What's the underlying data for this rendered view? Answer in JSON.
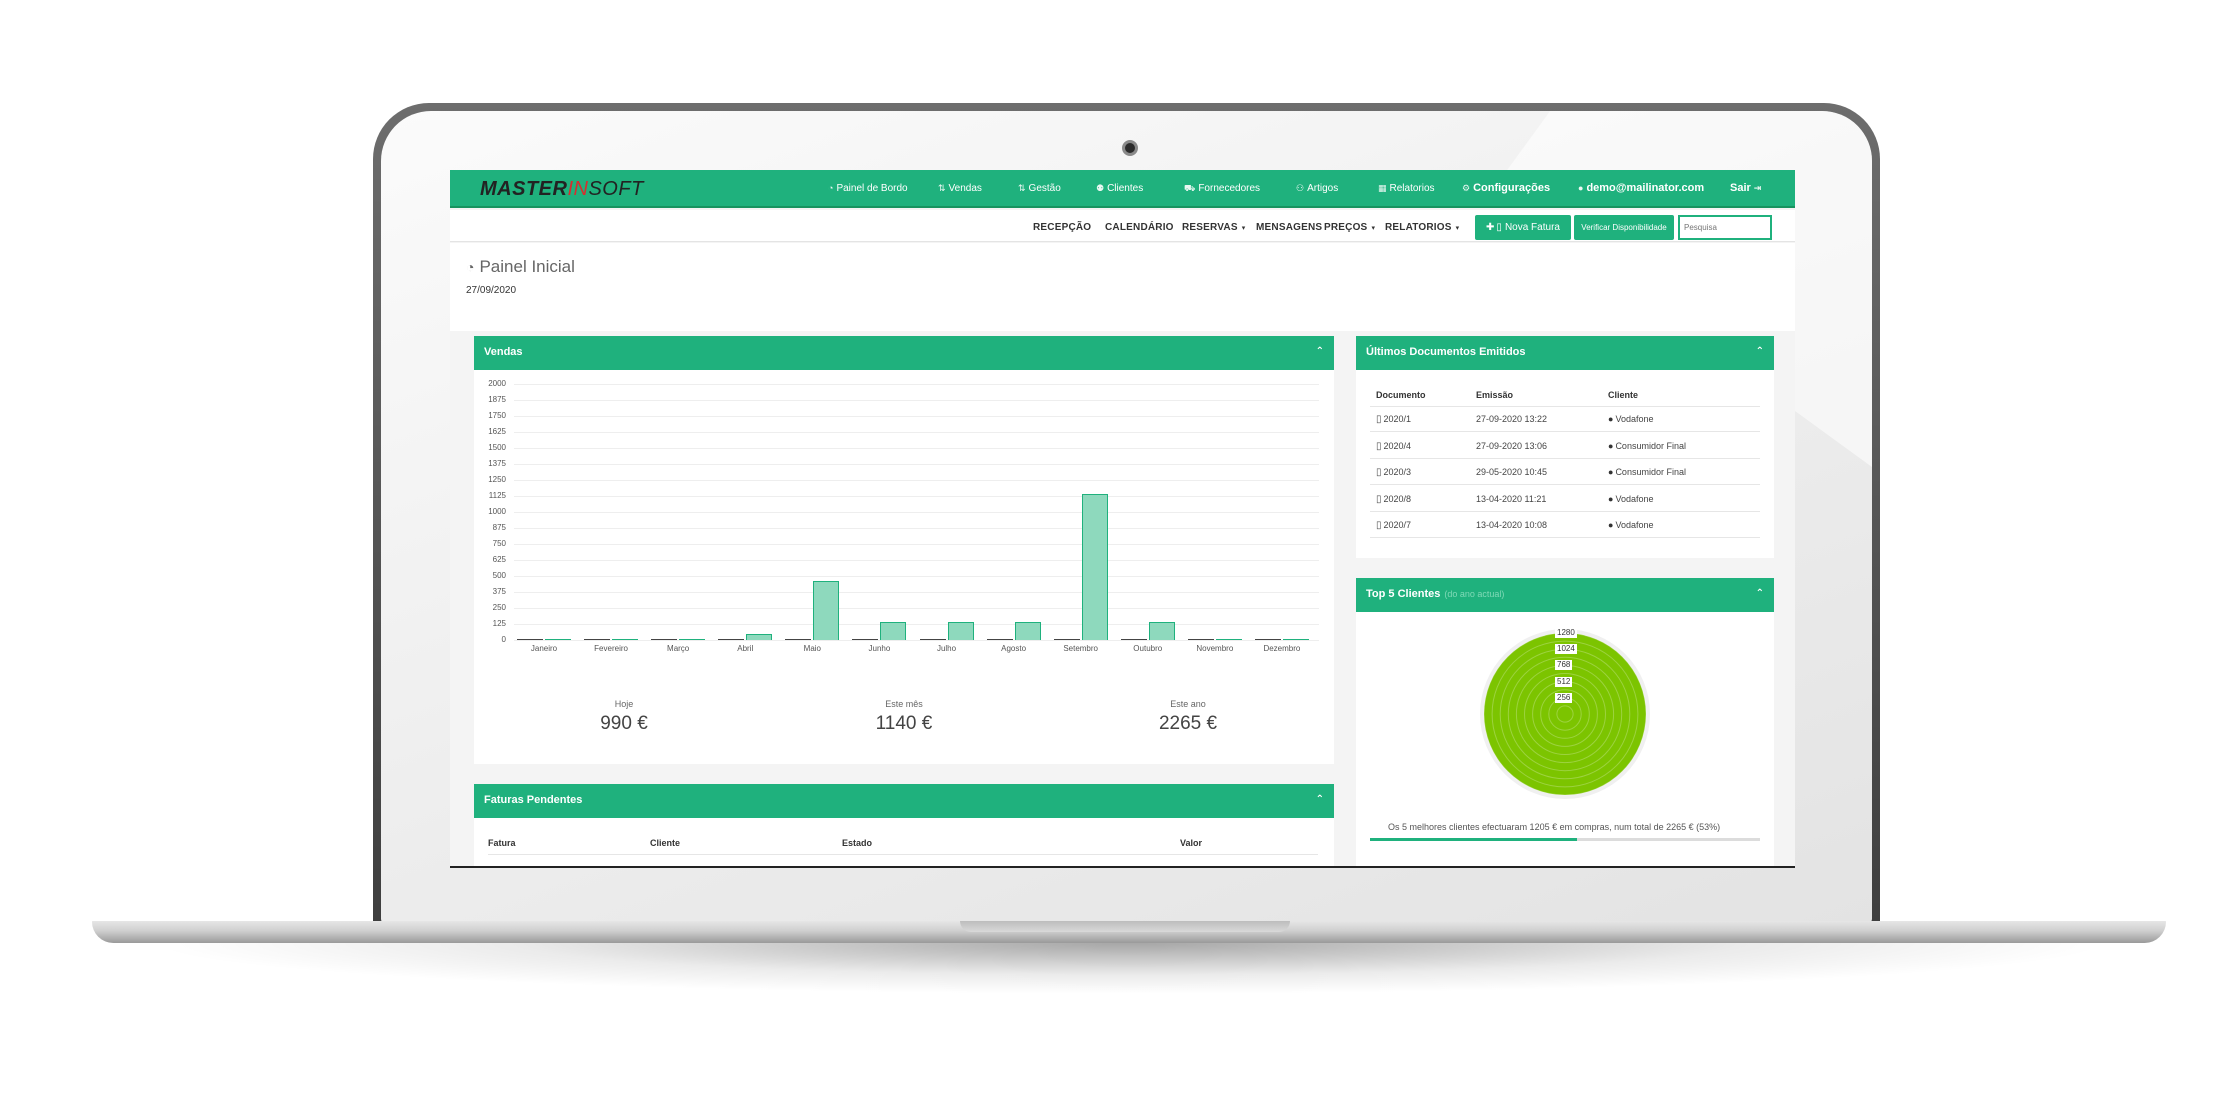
{
  "app": {
    "logo": {
      "part1": "MASTER",
      "part2": "IN",
      "part3": "SOFT"
    },
    "nav": [
      {
        "icon": "dashboard-icon",
        "label": "Painel de Bordo"
      },
      {
        "icon": "sales-icon",
        "label": "Vendas"
      },
      {
        "icon": "management-icon",
        "label": "Gestão"
      },
      {
        "icon": "clients-icon",
        "label": "Clientes"
      },
      {
        "icon": "suppliers-icon",
        "label": "Fornecedores"
      },
      {
        "icon": "articles-icon",
        "label": "Artigos"
      },
      {
        "icon": "reports-icon",
        "label": "Relatorios"
      },
      {
        "icon": "gears-icon",
        "label": "Configurações"
      },
      {
        "icon": "user-icon",
        "label": "demo@mailinator.com"
      },
      {
        "icon": "logout-icon",
        "label": "Sair"
      }
    ],
    "subnav": [
      {
        "label": "RECEPÇÃO",
        "dropdown": false
      },
      {
        "label": "CALENDÁRIO",
        "dropdown": false
      },
      {
        "label": "RESERVAS",
        "dropdown": true
      },
      {
        "label": "MENSAGENS",
        "dropdown": false
      },
      {
        "label": "PREÇOS",
        "dropdown": true
      },
      {
        "label": "RELATORIOS",
        "dropdown": true
      }
    ],
    "actions": {
      "new_invoice": "Nova Fatura",
      "check_availability": "Verificar Disponibilidade",
      "search_placeholder": "Pesquisa"
    },
    "accent_color": "#1fb17d"
  },
  "page": {
    "title": "Painel Inicial",
    "date": "27/09/2020"
  },
  "sales": {
    "title": "Vendas",
    "stats": [
      {
        "label": "Hoje",
        "value": "990 €"
      },
      {
        "label": "Este mês",
        "value": "1140 €"
      },
      {
        "label": "Este ano",
        "value": "2265 €"
      }
    ]
  },
  "chart_data": {
    "type": "bar",
    "categories": [
      "Janeiro",
      "Fevereiro",
      "Março",
      "Abril",
      "Maio",
      "Junho",
      "Julho",
      "Agosto",
      "Setembro",
      "Outubro",
      "Novembro",
      "Dezembro"
    ],
    "series": [
      {
        "values": [
          0,
          0,
          0,
          0,
          0,
          0,
          0,
          0,
          0,
          0,
          0,
          0
        ]
      },
      {
        "values": [
          0,
          0,
          0,
          50,
          460,
          140,
          140,
          140,
          1140,
          140,
          0,
          0
        ]
      }
    ],
    "y_ticks": [
      "2000",
      "1875",
      "1750",
      "1625",
      "1500",
      "1375",
      "1250",
      "1125",
      "1000",
      "875",
      "750",
      "625",
      "500",
      "375",
      "250",
      "125",
      "0"
    ],
    "ylim": [
      0,
      2000
    ],
    "grid": true
  },
  "documents": {
    "title": "Últimos Documentos Emitidos",
    "columns": [
      "Documento",
      "Emissão",
      "Cliente"
    ],
    "rows": [
      {
        "doc": "2020/1",
        "date": "27-09-2020 13:22",
        "client": "Vodafone"
      },
      {
        "doc": "2020/4",
        "date": "27-09-2020 13:06",
        "client": "Consumidor Final"
      },
      {
        "doc": "2020/3",
        "date": "29-05-2020 10:45",
        "client": "Consumidor Final"
      },
      {
        "doc": "2020/8",
        "date": "13-04-2020 11:21",
        "client": "Vodafone"
      },
      {
        "doc": "2020/7",
        "date": "13-04-2020 10:08",
        "client": "Vodafone"
      }
    ]
  },
  "top5": {
    "title": "Top 5 Clientes",
    "subtitle": "(do ano actual)",
    "scale_labels": [
      "1280",
      "1024",
      "768",
      "512",
      "256"
    ],
    "note": "Os 5 melhores clientes efectuaram 1205 € em compras, num total de 2265 € (53%)",
    "share_fraction": 0.53,
    "fill_color": "#7cc400"
  },
  "pending": {
    "title": "Faturas Pendentes",
    "columns": [
      "Fatura",
      "Cliente",
      "Estado",
      "Valor"
    ]
  }
}
